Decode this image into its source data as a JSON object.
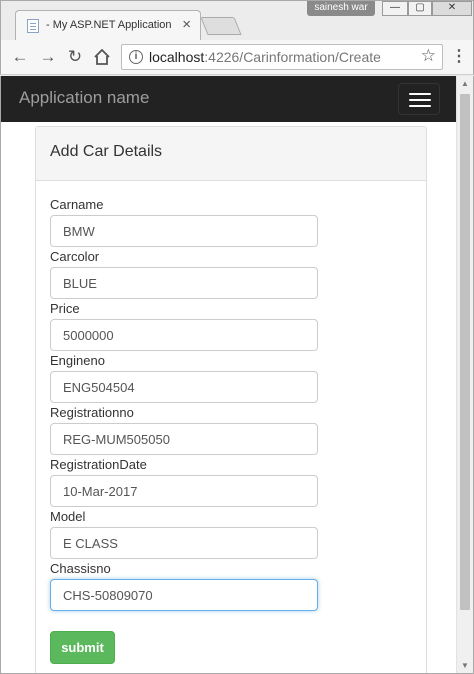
{
  "browser": {
    "tab_title": "- My ASP.NET Application",
    "tab_close": "×",
    "username": "sainesh war",
    "window_controls": {
      "minimize": "—",
      "maximize": "▢",
      "close": "✕"
    },
    "url_host": "localhost",
    "url_path": ":4226/Carinformation/Create",
    "icons": [
      "back-arrow-icon",
      "forward-arrow-icon",
      "reload-icon",
      "home-icon",
      "info-icon",
      "star-icon",
      "menu-icon"
    ]
  },
  "navbar": {
    "brand": "Application name"
  },
  "panel": {
    "title": "Add Car Details"
  },
  "form": {
    "fields": [
      {
        "label": "Carname",
        "value": "BMW"
      },
      {
        "label": "Carcolor",
        "value": "BLUE"
      },
      {
        "label": "Price",
        "value": "5000000"
      },
      {
        "label": "Engineno",
        "value": "ENG504504"
      },
      {
        "label": "Registrationno",
        "value": "REG-MUM505050"
      },
      {
        "label": "RegistrationDate",
        "value": "10-Mar-2017"
      },
      {
        "label": "Model",
        "value": "E CLASS"
      },
      {
        "label": "Chassisno",
        "value": "CHS-50809070"
      }
    ],
    "submit_label": "submit"
  },
  "colors": {
    "navbar": "#222222",
    "brand_text": "#9d9d9d",
    "submit": "#5cb85c",
    "focus": "#66afe9"
  }
}
